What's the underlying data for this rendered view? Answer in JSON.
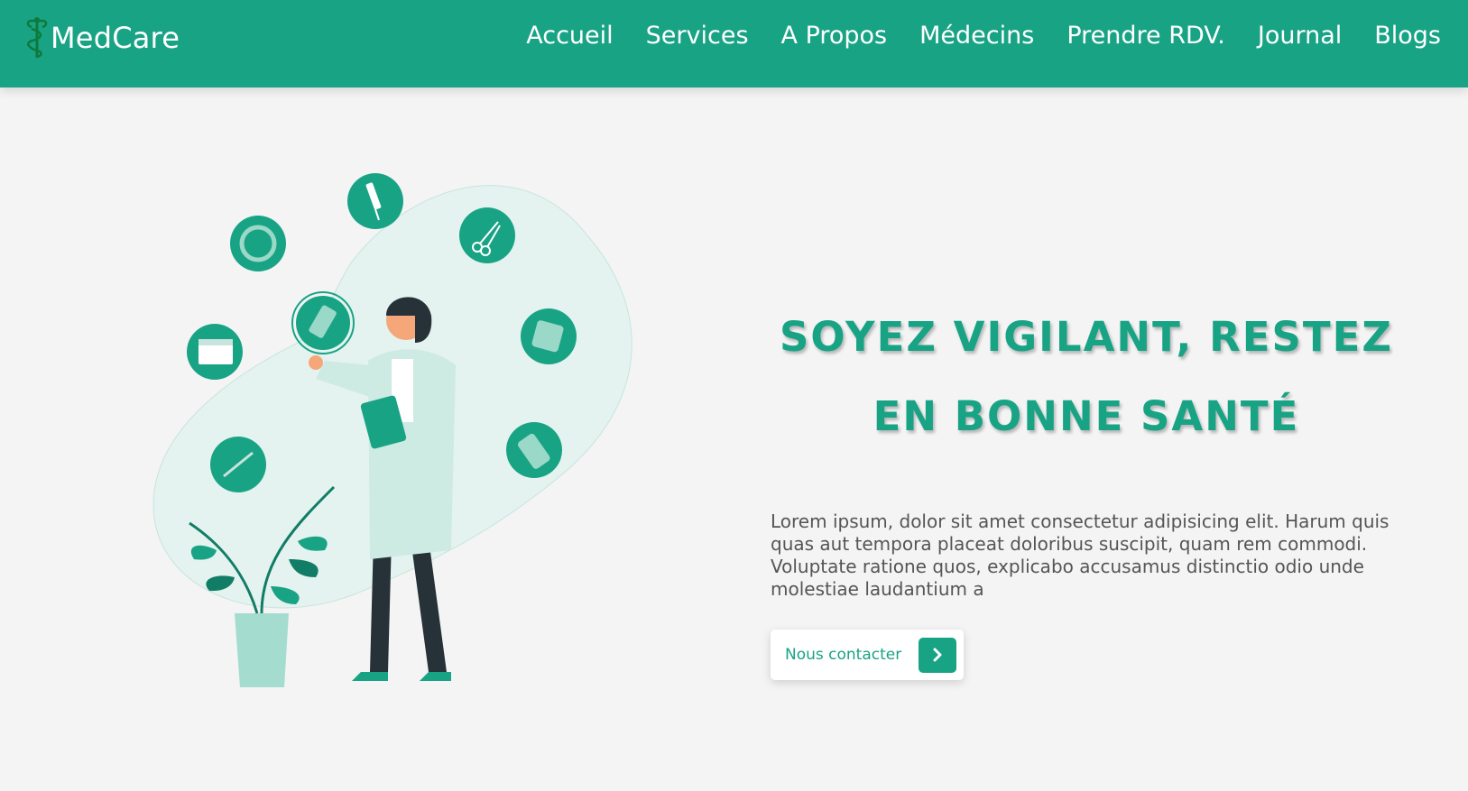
{
  "brand": {
    "name": "MedCare"
  },
  "nav": {
    "items": [
      {
        "label": "Accueil"
      },
      {
        "label": "Services"
      },
      {
        "label": "A Propos"
      },
      {
        "label": "Médecins"
      },
      {
        "label": "Prendre RDV."
      },
      {
        "label": "Journal"
      },
      {
        "label": "Blogs"
      }
    ]
  },
  "hero": {
    "title": "SOYEZ VIGILANT, RESTEZ EN BONNE SANTÉ",
    "description": "Lorem ipsum, dolor sit amet consectetur adipisicing elit. Harum quis quas aut tempora placeat doloribus suscipit, quam rem commodi. Voluptate ratione quos, explicabo accusamus distinctio odio unde molestiae laudantium a",
    "button_label": "Nous contacter"
  },
  "colors": {
    "primary": "#19a385",
    "background": "#f4f4f4",
    "text": "#555555"
  },
  "icons": [
    "caduceus-icon",
    "chevron-right-icon",
    "syringe-icon",
    "scissors-icon",
    "pills-icon",
    "calendar-icon",
    "thermometer-icon",
    "blister-pack-icon",
    "plaster-icon",
    "pill-bottle-icon"
  ]
}
